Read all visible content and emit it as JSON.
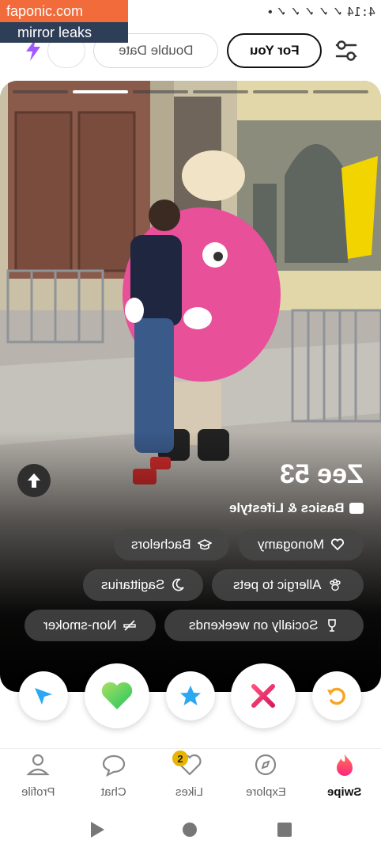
{
  "watermark": {
    "site": "faponic.com",
    "tagline": "mirror leaks"
  },
  "status_bar": {
    "time": "4:14"
  },
  "header": {
    "tabs": [
      {
        "label": "Double Date"
      },
      {
        "label": "For You",
        "selected": true
      }
    ]
  },
  "card": {
    "photo_count": 6,
    "active_photo": 2,
    "name_age": "Zee 53",
    "section_label": "Basics & Lifestyle",
    "tags": [
      {
        "label": "Monogamy",
        "icon": "heart-outline-icon"
      },
      {
        "label": "Bachelors",
        "icon": "graduation-cap-icon"
      },
      {
        "label": "Allergic to pets",
        "icon": "paw-icon"
      },
      {
        "label": "Sagittarius",
        "icon": "moon-icon"
      },
      {
        "label": "Socially on weekends",
        "icon": "wine-glass-icon"
      },
      {
        "label": "Non-smoker",
        "icon": "no-smoking-icon"
      }
    ]
  },
  "actions": [
    {
      "name": "rewind",
      "color": "#f5a623"
    },
    {
      "name": "nope",
      "color": "#f0336e"
    },
    {
      "name": "super-like",
      "color": "#2aa8f2"
    },
    {
      "name": "like",
      "color": "#4cd964"
    },
    {
      "name": "boost",
      "color": "#2aa8f2"
    }
  ],
  "bottom_nav": {
    "items": [
      {
        "label": "Swipe",
        "active": true
      },
      {
        "label": "Explore"
      },
      {
        "label": "Likes",
        "badge": "2"
      },
      {
        "label": "Chat"
      },
      {
        "label": "Profile"
      }
    ]
  },
  "colors": {
    "brand": "#fd5564",
    "pill_bg": "#464646",
    "card_bg": "#000000"
  }
}
